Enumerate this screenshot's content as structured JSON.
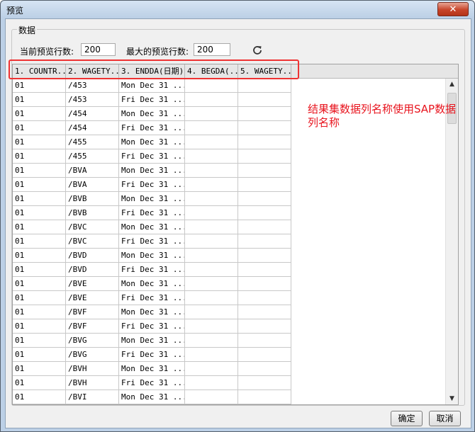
{
  "window": {
    "title": "预览",
    "close_symbol": "✕"
  },
  "group": {
    "label": "数据"
  },
  "controls": {
    "current_rows_label": "当前预览行数:",
    "current_rows_value": "200",
    "max_rows_label": "最大的预览行数:",
    "max_rows_value": "200",
    "refresh_icon": "refresh-icon"
  },
  "columns": [
    "1. COUNTR...",
    "2. WAGETY...",
    "3. ENDDA(日期)",
    "4. BEGDA(...",
    "5. WAGETY..."
  ],
  "rows": [
    [
      "01",
      "/453",
      "Mon Dec 31 ...",
      "",
      ""
    ],
    [
      "01",
      "/453",
      "Fri Dec 31 ...",
      "",
      ""
    ],
    [
      "01",
      "/454",
      "Mon Dec 31 ...",
      "",
      ""
    ],
    [
      "01",
      "/454",
      "Fri Dec 31 ...",
      "",
      ""
    ],
    [
      "01",
      "/455",
      "Mon Dec 31 ...",
      "",
      ""
    ],
    [
      "01",
      "/455",
      "Fri Dec 31 ...",
      "",
      ""
    ],
    [
      "01",
      "/BVA",
      "Mon Dec 31 ...",
      "",
      ""
    ],
    [
      "01",
      "/BVA",
      "Fri Dec 31 ...",
      "",
      ""
    ],
    [
      "01",
      "/BVB",
      "Mon Dec 31 ...",
      "",
      ""
    ],
    [
      "01",
      "/BVB",
      "Fri Dec 31 ...",
      "",
      ""
    ],
    [
      "01",
      "/BVC",
      "Mon Dec 31 ...",
      "",
      ""
    ],
    [
      "01",
      "/BVC",
      "Fri Dec 31 ...",
      "",
      ""
    ],
    [
      "01",
      "/BVD",
      "Mon Dec 31 ...",
      "",
      ""
    ],
    [
      "01",
      "/BVD",
      "Fri Dec 31 ...",
      "",
      ""
    ],
    [
      "01",
      "/BVE",
      "Mon Dec 31 ...",
      "",
      ""
    ],
    [
      "01",
      "/BVE",
      "Fri Dec 31 ...",
      "",
      ""
    ],
    [
      "01",
      "/BVF",
      "Mon Dec 31 ...",
      "",
      ""
    ],
    [
      "01",
      "/BVF",
      "Fri Dec 31 ...",
      "",
      ""
    ],
    [
      "01",
      "/BVG",
      "Mon Dec 31 ...",
      "",
      ""
    ],
    [
      "01",
      "/BVG",
      "Fri Dec 31 ...",
      "",
      ""
    ],
    [
      "01",
      "/BVH",
      "Mon Dec 31 ...",
      "",
      ""
    ],
    [
      "01",
      "/BVH",
      "Fri Dec 31 ...",
      "",
      ""
    ],
    [
      "01",
      "/BVI",
      "Mon Dec 31 ...",
      "",
      ""
    ]
  ],
  "annotation": "结果集数据列名称使用SAP数据列名称",
  "annotation_color": "#e8141e",
  "buttons": {
    "ok": "确定",
    "cancel": "取消"
  },
  "scrollbar": {
    "up": "▲",
    "down": "▼"
  }
}
